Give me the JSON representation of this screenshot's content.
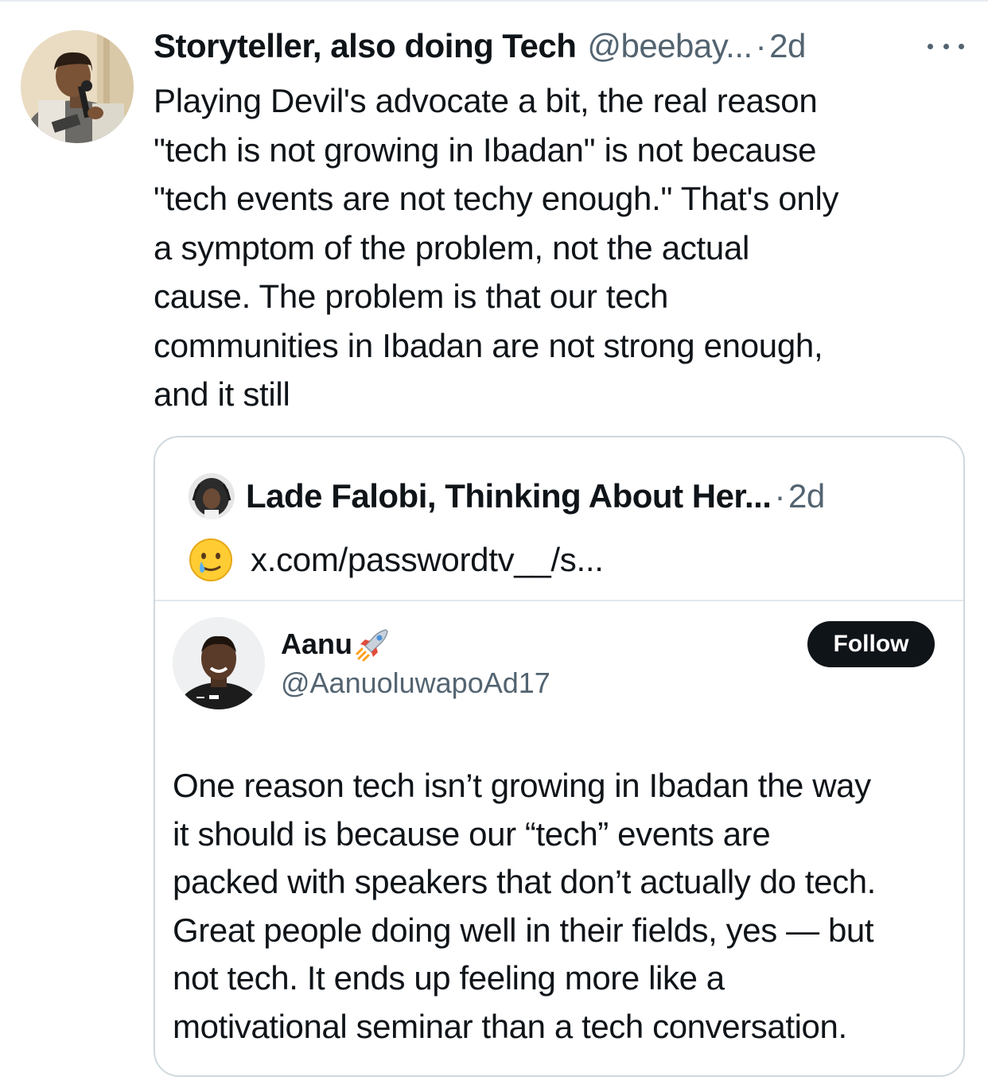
{
  "post": {
    "author_name": "Storyteller, also doing Tech",
    "author_handle": "@beebay...",
    "separator": "·",
    "time": "2d",
    "text_lines": [
      "Playing Devil's advocate a bit, the real reason",
      "\"tech is not growing in Ibadan\" is not because",
      "\"tech events are not techy enough.\" That's only",
      "a symptom of the problem, not the actual",
      "cause. The problem is that our tech",
      "communities in Ibadan are not strong enough,",
      "and it still"
    ]
  },
  "quote": {
    "author_name": "Lade Falobi, Thinking About Her...",
    "separator": "·",
    "time": "2d",
    "emoji_icon": "crying-smile-emoji",
    "link_text": "x.com/passwordtv__/s..."
  },
  "embedded": {
    "name": "Aanu",
    "name_icon": "rocket-icon",
    "handle": "@AanuoluwapoAd17",
    "follow_label": "Follow",
    "text_lines": [
      "One reason tech isn’t growing in Ibadan the way",
      "it should is because our “tech” events are",
      "packed with speakers that don’t actually do tech.",
      "Great people doing well in their fields, yes — but",
      "not tech. It ends up feeling more like a",
      "motivational seminar than a tech conversation."
    ]
  },
  "colors": {
    "text": "#0f1419",
    "secondary": "#536471",
    "border": "#cfd9de",
    "button_bg": "#0f1419"
  }
}
